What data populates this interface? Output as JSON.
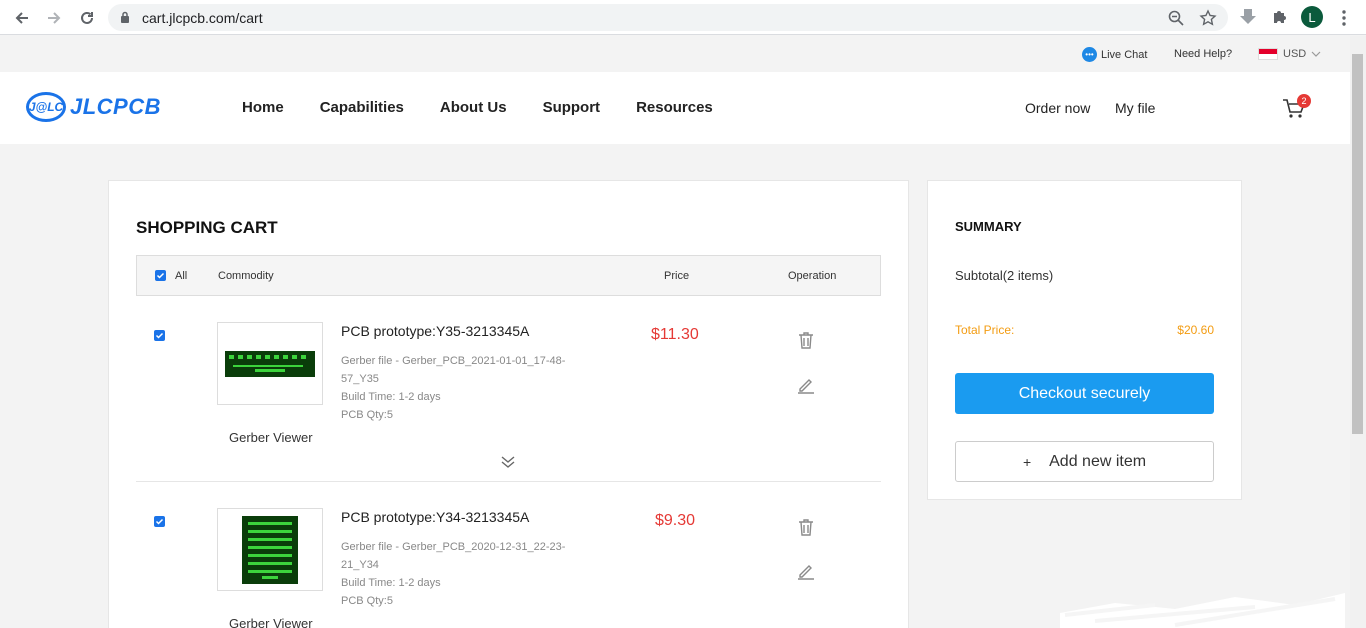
{
  "browser": {
    "url": "cart.jlcpcb.com/cart",
    "profile_initial": "L"
  },
  "util": {
    "live_chat": "Live Chat",
    "need_help": "Need Help?",
    "currency": "USD"
  },
  "header": {
    "logo_mark": "J@LC",
    "logo_text": "JLCPCB",
    "nav": [
      "Home",
      "Capabilities",
      "About Us",
      "Support",
      "Resources"
    ],
    "order_now": "Order now",
    "my_file": "My file",
    "cart_count": "2"
  },
  "cart": {
    "title": "SHOPPING CART",
    "columns": {
      "all": "All",
      "commodity": "Commodity",
      "price": "Price",
      "operation": "Operation"
    },
    "items": [
      {
        "title": "PCB prototype:Y35-3213345A",
        "gerber_file": "Gerber file - Gerber_PCB_2021-01-01_17-48-57_Y35",
        "build_time": "Build Time: 1-2 days",
        "qty": "PCB Qty:5",
        "price": "$11.30",
        "viewer": "Gerber Viewer"
      },
      {
        "title": "PCB prototype:Y34-3213345A",
        "gerber_file": "Gerber file - Gerber_PCB_2020-12-31_22-23-21_Y34",
        "build_time": "Build Time: 1-2 days",
        "qty": "PCB Qty:5",
        "price": "$9.30",
        "viewer": "Gerber Viewer"
      }
    ]
  },
  "summary": {
    "title": "SUMMARY",
    "subtotal": "Subtotal(2 items)",
    "total_label": "Total Price:",
    "total_value": "$20.60",
    "checkout": "Checkout securely",
    "add_new": "Add new item"
  },
  "colors": {
    "brand_blue": "#1a73e8",
    "checkout_blue": "#1a9bf0",
    "price_red": "#e53935",
    "total_orange": "#f39c12"
  }
}
